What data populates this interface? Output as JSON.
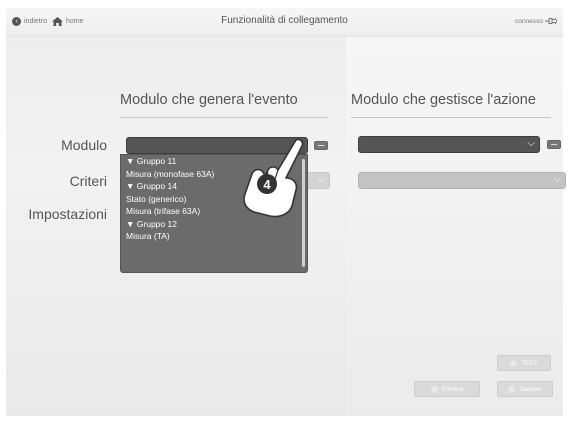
{
  "topbar": {
    "back_label": "indietro",
    "home_label": "home",
    "title": "Funzionalità di collegamento",
    "status_label": "connesso"
  },
  "left_column": {
    "title": "Modulo che genera l'evento"
  },
  "right_column": {
    "title": "Modulo che gestisce l'azione"
  },
  "rows": {
    "modulo": "Modulo",
    "criteri": "Criteri",
    "impostazioni": "Impostazioni"
  },
  "dropdown": {
    "items": [
      "▼ Gruppo 11",
      "Misura (monofase 63A)",
      "▼ Gruppo 14",
      "Stato (generico)",
      "Misura (trifase 63A)",
      "▼ Gruppo 12",
      "Misura (TA)"
    ]
  },
  "step_badge": "4",
  "buttons": {
    "test": "TEST",
    "elimina": "Elimina",
    "salvare": "Salvare"
  },
  "icons": {
    "back": "back-arrow-circle-icon",
    "home": "home-icon",
    "connection": "plug-icon",
    "chevron": "chevron-down-icon",
    "minus": "minus-icon"
  },
  "colors": {
    "select_dark": "#555555",
    "select_light": "#c3c3c3",
    "dropdown_bg": "#6b6b6b"
  }
}
